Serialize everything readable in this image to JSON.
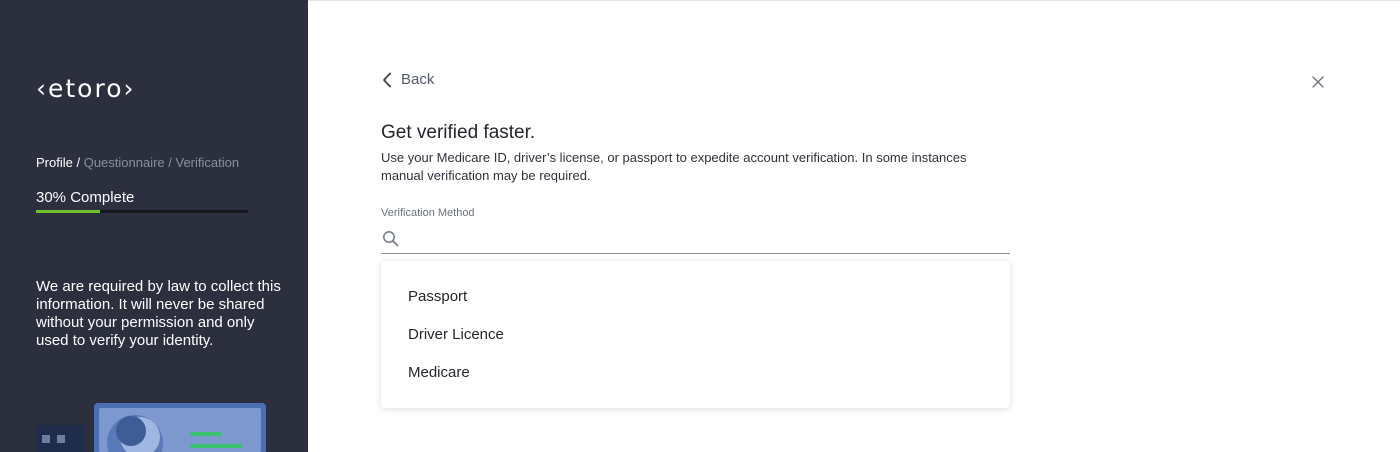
{
  "sidebar": {
    "logo": "‹etoro›",
    "breadcrumb": {
      "current": "Profile",
      "sep1": " / ",
      "step2": "Questionnaire",
      "sep2": " / ",
      "step3": "Verification"
    },
    "progress_label": "30% Complete",
    "progress_fraction": 0.3,
    "legal_text": "We are required by law to collect this information. It will never be shared without your permission and only used to verify your identity.",
    "colors": {
      "background": "#2b2f3e",
      "progress": "#6fc22b"
    }
  },
  "main": {
    "back_label": "Back",
    "heading": "Get verified faster.",
    "description": "Use your Medicare ID, driver’s license, or passport to expedite account verification. In some instances manual verification may be required.",
    "field_label": "Verification Method",
    "search_value": "",
    "options": [
      "Passport",
      "Driver Licence",
      "Medicare"
    ]
  }
}
